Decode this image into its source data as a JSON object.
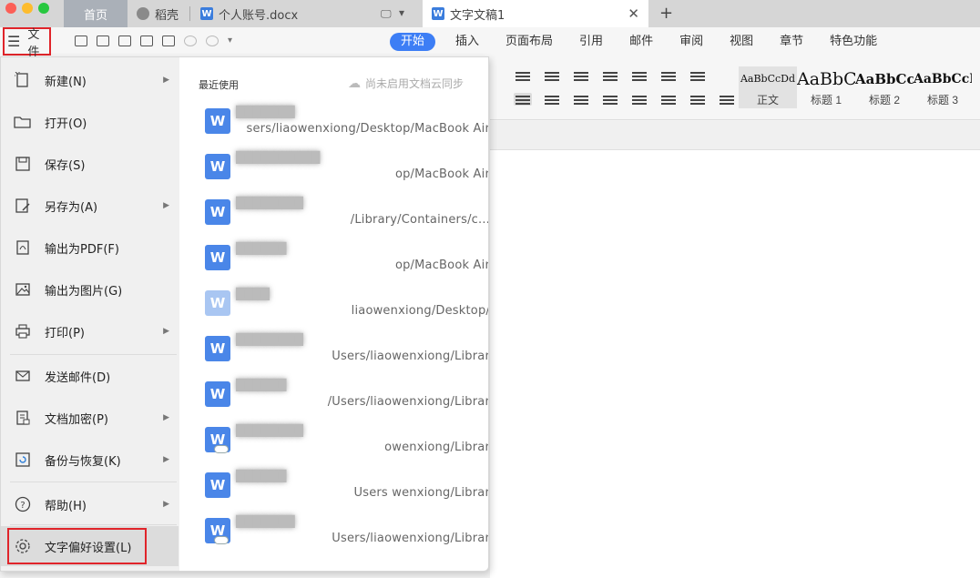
{
  "window": {
    "tabs": [
      {
        "label": "首页"
      },
      {
        "label": "稻壳"
      },
      {
        "label": "个人账号.docx"
      },
      {
        "label": "文字文稿1"
      }
    ],
    "add_tab": "+",
    "close_tab": "✕"
  },
  "toolbar": {
    "file_menu_label": "文件",
    "ribbon_tabs": [
      "开始",
      "插入",
      "页面布局",
      "引用",
      "邮件",
      "审阅",
      "视图",
      "章节",
      "特色功能"
    ],
    "active_ribbon_tab": "开始"
  },
  "styles_gallery": [
    {
      "preview": "AaBbCcDd",
      "name": "正文",
      "selected": true
    },
    {
      "preview": "AaBbC",
      "name": "标题 1"
    },
    {
      "preview": "AaBbCc",
      "name": "标题 2"
    },
    {
      "preview": "AaBbCcI",
      "name": "标题 3"
    }
  ],
  "file_menu": {
    "items": [
      {
        "label": "新建(N)",
        "icon": "new-doc-icon",
        "has_submenu": true
      },
      {
        "label": "打开(O)",
        "icon": "folder-icon",
        "has_submenu": false
      },
      {
        "label": "保存(S)",
        "icon": "save-icon",
        "has_submenu": false
      },
      {
        "label": "另存为(A)",
        "icon": "save-as-icon",
        "has_submenu": true
      },
      {
        "label": "输出为PDF(F)",
        "icon": "pdf-icon",
        "has_submenu": false
      },
      {
        "label": "输出为图片(G)",
        "icon": "image-icon",
        "has_submenu": false
      },
      {
        "label": "打印(P)",
        "icon": "printer-icon",
        "has_submenu": true
      },
      {
        "label": "发送邮件(D)",
        "icon": "mail-icon",
        "has_submenu": false
      },
      {
        "label": "文档加密(P)",
        "icon": "lock-doc-icon",
        "has_submenu": true
      },
      {
        "label": "备份与恢复(K)",
        "icon": "backup-icon",
        "has_submenu": true
      },
      {
        "label": "帮助(H)",
        "icon": "help-icon",
        "has_submenu": true
      },
      {
        "label": "文字偏好设置(L)",
        "icon": "gear-icon",
        "has_submenu": false
      }
    ],
    "recent": {
      "title": "最近使用",
      "sync_status": "尚未启用文档云同步",
      "files": [
        {
          "path": "sers/liaowenxiong/Desktop/MacBook Air",
          "pale": false,
          "cloud": false
        },
        {
          "path": "op/MacBook Air",
          "pale": false,
          "cloud": false
        },
        {
          "path": "/Library/Containers/c...",
          "pale": false,
          "cloud": false
        },
        {
          "path": "op/MacBook Air",
          "pale": false,
          "cloud": false
        },
        {
          "path": "liaowenxiong/Desktop/",
          "pale": true,
          "cloud": false
        },
        {
          "path": "Users/liaowenxiong/Librar",
          "pale": false,
          "cloud": false
        },
        {
          "path": "/Users/liaowenxiong/Librar",
          "pale": false,
          "cloud": false
        },
        {
          "path": "owenxiong/Librar",
          "pale": false,
          "cloud": true
        },
        {
          "path": "Users  wenxiong/Librar",
          "pale": false,
          "cloud": false
        },
        {
          "path": "Users/liaowenxiong/Librar",
          "pale": false,
          "cloud": true
        }
      ]
    }
  },
  "colors": {
    "accent": "#3d7ef5",
    "highlight_box": "#e0242a",
    "doc_icon": "#4a86e8"
  }
}
